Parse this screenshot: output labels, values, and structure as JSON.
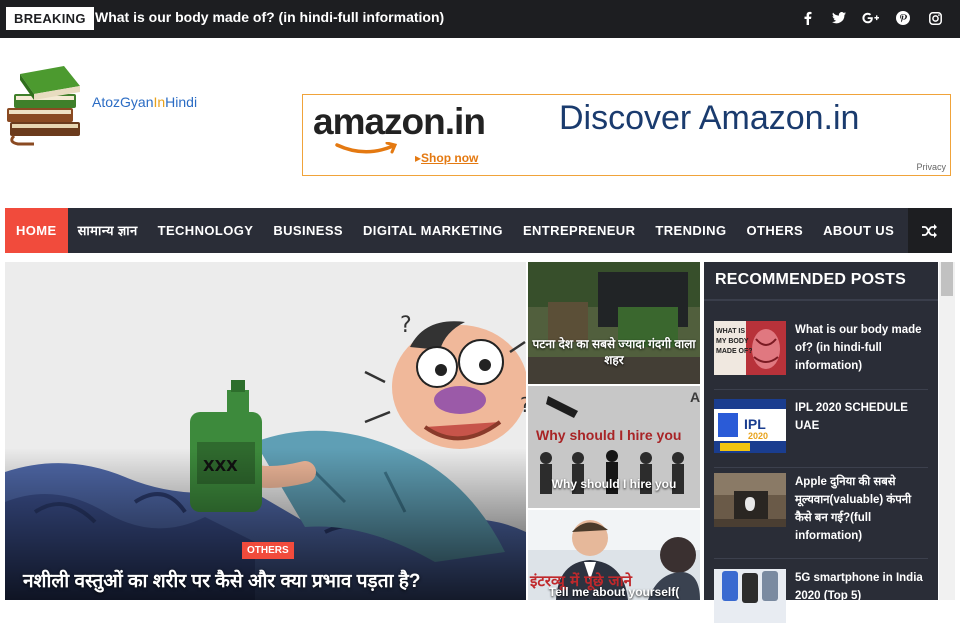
{
  "topbar": {
    "breaking_label": "BREAKING",
    "breaking_text": "What is our body made of? (in hindi-full information)",
    "social_icons": [
      "facebook-icon",
      "twitter-icon",
      "google-plus-icon",
      "pinterest-icon",
      "instagram-icon"
    ]
  },
  "header": {
    "logo_text_a": "AtozGyan",
    "logo_text_b": "In",
    "logo_text_c": "Hindi",
    "ad": {
      "brand": "amazon.in",
      "shop_now": "Shop now",
      "headline": "Discover Amazon.in",
      "privacy": "Privacy"
    }
  },
  "nav": {
    "items": [
      {
        "label": "HOME",
        "active": true
      },
      {
        "label": "सामान्य ज्ञान"
      },
      {
        "label": "TECHNOLOGY"
      },
      {
        "label": "BUSINESS"
      },
      {
        "label": "DIGITAL MARKETING"
      },
      {
        "label": "ENTREPRENEUR"
      },
      {
        "label": "TRENDING"
      },
      {
        "label": "OTHERS"
      },
      {
        "label": "ABOUT US"
      }
    ],
    "shuffle_icon": "shuffle-icon"
  },
  "feature": {
    "badge": "OTHERS",
    "title": "नशीली वस्तुओं का शरीर पर कैसे और क्या प्रभाव पड़ता है?"
  },
  "middle_posts": [
    {
      "caption": "पटना देश का सबसे ज्यादा गंदगी वाला शहर"
    },
    {
      "caption": "Why should I hire you",
      "image_text": "Why should I hire you"
    },
    {
      "caption": "Tell me about yourself(",
      "image_text": "इंटरव्यू में पूछे जाने"
    }
  ],
  "sidebar": {
    "title": "RECOMMENDED POSTS",
    "items": [
      {
        "title": "What is our body made of? (in hindi-full information)",
        "thumb_text": "WHAT IS MY BODY MADE OF?"
      },
      {
        "title": "IPL 2020 SCHEDULE UAE",
        "thumb_text": "IPL 2020"
      },
      {
        "title": "Apple दुनिया की सबसे मूल्यवान(valuable) कंपनी कैसे बन गई?(full information)"
      },
      {
        "title": "5G smartphone in India 2020 (Top 5)"
      }
    ]
  },
  "colors": {
    "accent": "#f14b3c",
    "nav_bg": "#2a2d37",
    "topbar_bg": "#1d1e21"
  }
}
